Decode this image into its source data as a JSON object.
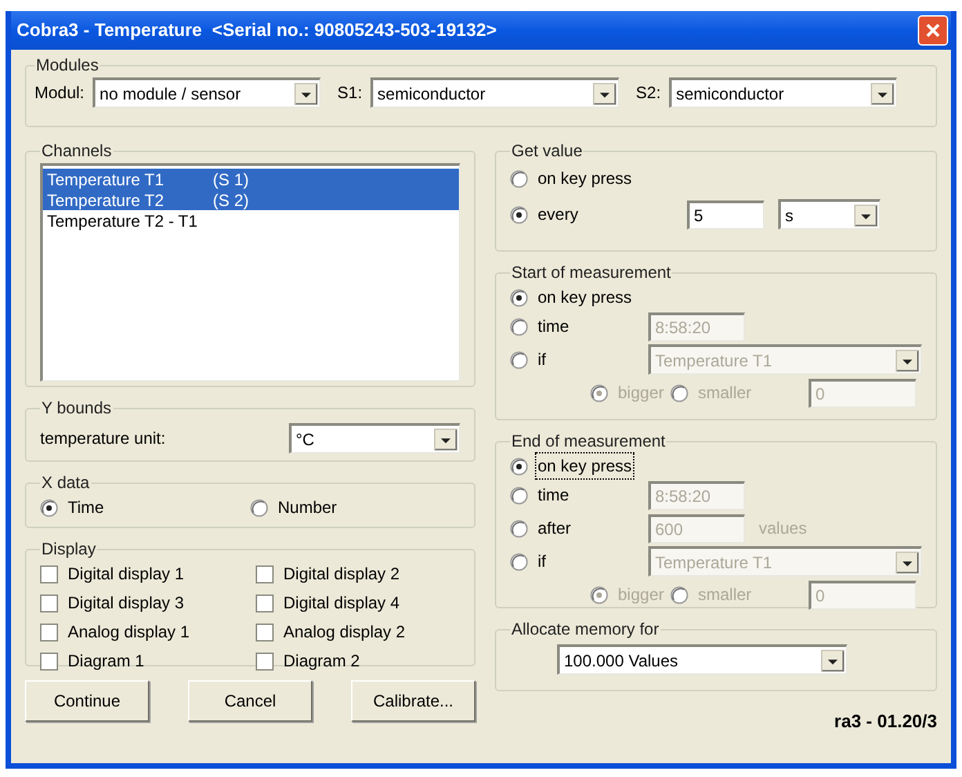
{
  "window": {
    "title": "Cobra3 - Temperature  <Serial no.: 90805243-503-19132>"
  },
  "modules": {
    "label": "Modules",
    "selectors": [
      {
        "label": "Modul:",
        "value": "no module / sensor"
      },
      {
        "label": "S1:",
        "value": "semiconductor"
      },
      {
        "label": "S2:",
        "value": "semiconductor"
      }
    ]
  },
  "channels": {
    "label": "Channels",
    "items": [
      {
        "name": "Temperature T1",
        "sensor": "(S 1)",
        "selected": true
      },
      {
        "name": "Temperature T2",
        "sensor": "(S 2)",
        "selected": true
      },
      {
        "name": "Temperature T2 - T1",
        "selected": false
      }
    ]
  },
  "y_bounds": {
    "label": "Y bounds",
    "unit_label": "temperature unit:",
    "unit": "°C"
  },
  "x_data": {
    "label": "X data",
    "options": [
      {
        "label": "Time",
        "selected": true
      },
      {
        "label": "Number",
        "selected": false
      }
    ]
  },
  "display": {
    "label": "Display",
    "items": [
      {
        "label": "Digital display 1",
        "checked": false
      },
      {
        "label": "Digital display 2",
        "checked": false
      },
      {
        "label": "Digital display 3",
        "checked": false
      },
      {
        "label": "Digital display 4",
        "checked": false
      },
      {
        "label": "Analog display 1",
        "checked": false
      },
      {
        "label": "Analog display 2",
        "checked": false
      },
      {
        "label": "Diagram 1",
        "checked": false
      },
      {
        "label": "Diagram 2",
        "checked": false
      }
    ]
  },
  "buttons": [
    "Continue",
    "Cancel",
    "Calibrate..."
  ],
  "get_value": {
    "label": "Get value",
    "options": [
      {
        "kind": "plain",
        "label": "on key press",
        "selected": false
      },
      {
        "kind": "interval",
        "label": "every",
        "selected": true,
        "value": "5",
        "unit": "s"
      }
    ]
  },
  "start_of_measurement": {
    "label": "Start of measurement",
    "options": [
      {
        "kind": "plain",
        "label": "on key press",
        "selected": true
      },
      {
        "kind": "time",
        "label": "time",
        "selected": false,
        "value": "8:58:20",
        "disabled": true
      },
      {
        "kind": "condition",
        "label": "if",
        "selected": false,
        "channel": "Temperature T1",
        "disabled": true,
        "comparisons": [
          {
            "label": "bigger",
            "selected": true
          },
          {
            "label": "smaller",
            "selected": false
          }
        ],
        "threshold": "0"
      }
    ]
  },
  "end_of_measurement": {
    "label": "End of measurement",
    "options": [
      {
        "kind": "plain",
        "label": "on key press",
        "selected": true,
        "focused": true
      },
      {
        "kind": "time",
        "label": "time",
        "selected": false,
        "focused": false,
        "value": "8:58:20",
        "disabled": true
      },
      {
        "kind": "count",
        "label": "after",
        "selected": false,
        "focused": false,
        "value": "600",
        "suffix": "values",
        "disabled": true
      },
      {
        "kind": "condition",
        "label": "if",
        "selected": false,
        "focused": false,
        "channel": "Temperature T1",
        "disabled": true,
        "comparisons": [
          {
            "label": "bigger",
            "selected": true
          },
          {
            "label": "smaller",
            "selected": false
          }
        ],
        "threshold": "0"
      }
    ]
  },
  "allocate_memory": {
    "label": "Allocate memory for",
    "value": "100.000 Values"
  },
  "version": "ra3 - 01.20/3"
}
